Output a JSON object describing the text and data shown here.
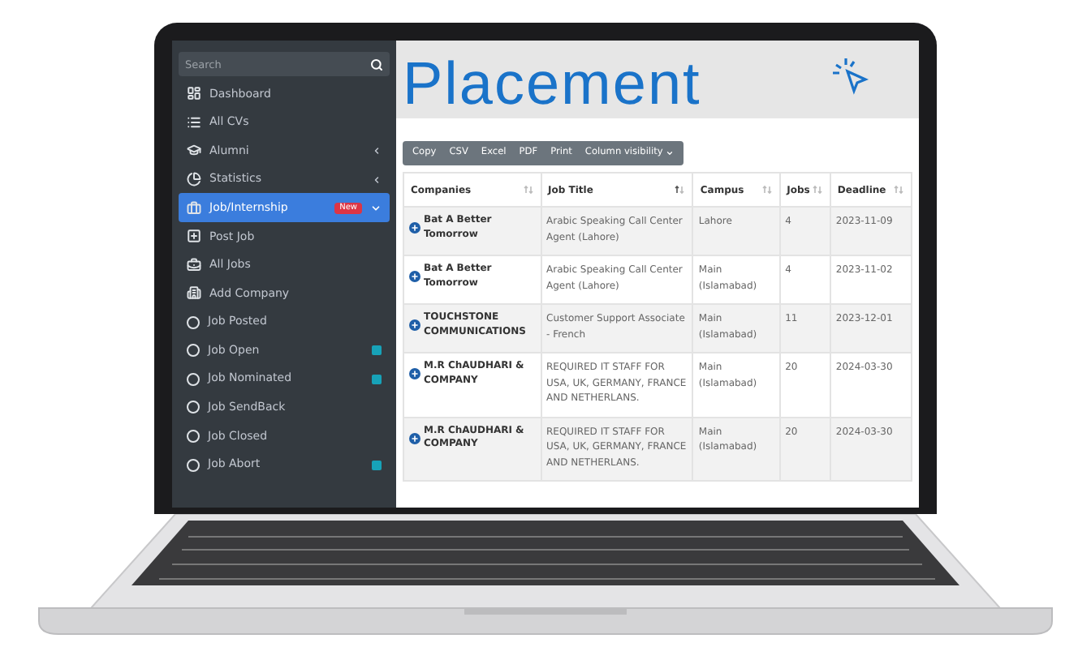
{
  "sidebar": {
    "search": {
      "placeholder": "Search"
    },
    "items": [
      {
        "label": "Dashboard",
        "kind": "icon",
        "selected": false
      },
      {
        "label": "All CVs",
        "kind": "icon",
        "selected": false
      },
      {
        "label": "Alumni",
        "kind": "icon",
        "selected": false,
        "expanded": false
      },
      {
        "label": "Statistics",
        "kind": "icon",
        "selected": false,
        "expanded": false
      },
      {
        "label": "Job/Internship",
        "kind": "icon",
        "selected": true,
        "badge": "New",
        "expanded": true
      },
      {
        "label": "Post Job",
        "kind": "icon",
        "selected": false
      },
      {
        "label": "All Jobs",
        "kind": "icon",
        "selected": false
      },
      {
        "label": "Add Company",
        "kind": "icon",
        "selected": false
      },
      {
        "label": "Job Posted",
        "kind": "circle",
        "selected": false
      },
      {
        "label": "Job Open",
        "kind": "circle",
        "selected": false,
        "counter": true
      },
      {
        "label": "Job Nominated",
        "kind": "circle",
        "selected": false,
        "counter": true
      },
      {
        "label": "Job SendBack",
        "kind": "circle",
        "selected": false
      },
      {
        "label": "Job Closed",
        "kind": "circle",
        "selected": false
      },
      {
        "label": "Job Abort",
        "kind": "circle",
        "selected": false,
        "counter": true
      }
    ]
  },
  "page_title": "Placement",
  "toolbar": {
    "buttons": [
      "Copy",
      "CSV",
      "Excel",
      "PDF",
      "Print"
    ],
    "dropdown": "Column visibility"
  },
  "table": {
    "columns": [
      {
        "label": "Companies",
        "sorted": false
      },
      {
        "label": "Job Title",
        "sorted": true
      },
      {
        "label": "Campus",
        "sorted": false
      },
      {
        "label": "Jobs",
        "sorted": false
      },
      {
        "label": "Deadline",
        "sorted": false
      }
    ],
    "rows": [
      [
        "Bat A Better Tomorrow",
        "Arabic Speaking Call Center Agent (Lahore)",
        "Lahore",
        "4",
        "2023-11-09"
      ],
      [
        "Bat A Better Tomorrow",
        "Arabic Speaking Call Center Agent (Lahore)",
        "Main (Islamabad)",
        "4",
        "2023-11-02"
      ],
      [
        "TOUCHSTONE COMMUNICATIONS",
        "Customer Support Associate - French",
        "Main (Islamabad)",
        "11",
        "2023-12-01"
      ],
      [
        "M.R ChAUDHARI & COMPANY",
        "REQUIRED IT STAFF FOR USA, UK, GERMANY, FRANCE AND NETHERLANS.",
        "Main (Islamabad)",
        "20",
        "2024-03-30"
      ],
      [
        "M.R ChAUDHARI & COMPANY",
        "REQUIRED IT STAFF FOR USA, UK, GERMANY, FRANCE AND NETHERLANS.",
        "Main (Islamabad)",
        "20",
        "2024-03-30"
      ]
    ]
  }
}
